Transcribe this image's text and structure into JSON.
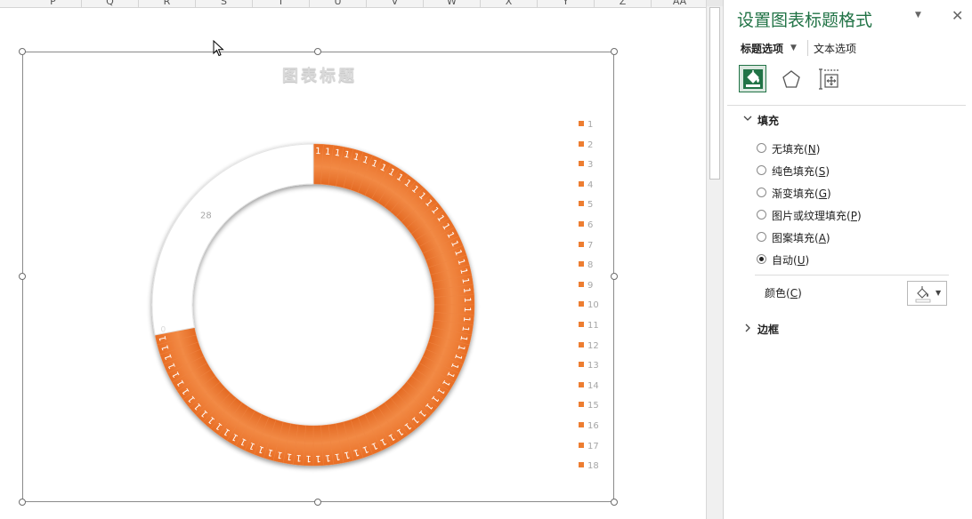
{
  "sheet": {
    "columns": [
      "P",
      "Q",
      "R",
      "S",
      "T",
      "U",
      "V",
      "W",
      "X",
      "Y",
      "Z",
      "AA"
    ]
  },
  "chart": {
    "title": "图表标题",
    "legend": [
      "1",
      "2",
      "3",
      "4",
      "5",
      "6",
      "7",
      "8",
      "9",
      "10",
      "11",
      "12",
      "13",
      "14",
      "15",
      "16",
      "17",
      "18"
    ],
    "colors": {
      "series": "#ed7d31",
      "remainder": "#ffffff"
    }
  },
  "chart_data": {
    "type": "doughnut",
    "title": "图表标题",
    "categories": [
      "1",
      "2",
      "3",
      "4",
      "5",
      "6",
      "7",
      "8",
      "9",
      "10",
      "11",
      "12",
      "13",
      "14",
      "15",
      "16",
      "17",
      "18"
    ],
    "segments": {
      "unit_value": 1,
      "unit_label": "1",
      "unit_count": 72,
      "remainder_value": 28,
      "remainder_label": "28",
      "remainder_marker": "0"
    },
    "legend_position": "right"
  },
  "panel": {
    "title": "设置图表标题格式",
    "tabs": {
      "title_options": "标题选项",
      "text_options": "文本选项"
    },
    "icons": [
      "fill-line-icon",
      "effects-pentagon-icon",
      "size-properties-icon"
    ],
    "fill_section": "填充",
    "fill_options": [
      {
        "label": "无填充",
        "key": "N",
        "checked": false
      },
      {
        "label": "纯色填充",
        "key": "S",
        "checked": false
      },
      {
        "label": "渐变填充",
        "key": "G",
        "checked": false
      },
      {
        "label": "图片或纹理填充",
        "key": "P",
        "checked": false
      },
      {
        "label": "图案填充",
        "key": "A",
        "checked": false
      },
      {
        "label": "自动",
        "key": "U",
        "checked": true
      }
    ],
    "color_label": "颜色",
    "color_key": "C",
    "border_section": "边框",
    "accent": "#217346"
  }
}
